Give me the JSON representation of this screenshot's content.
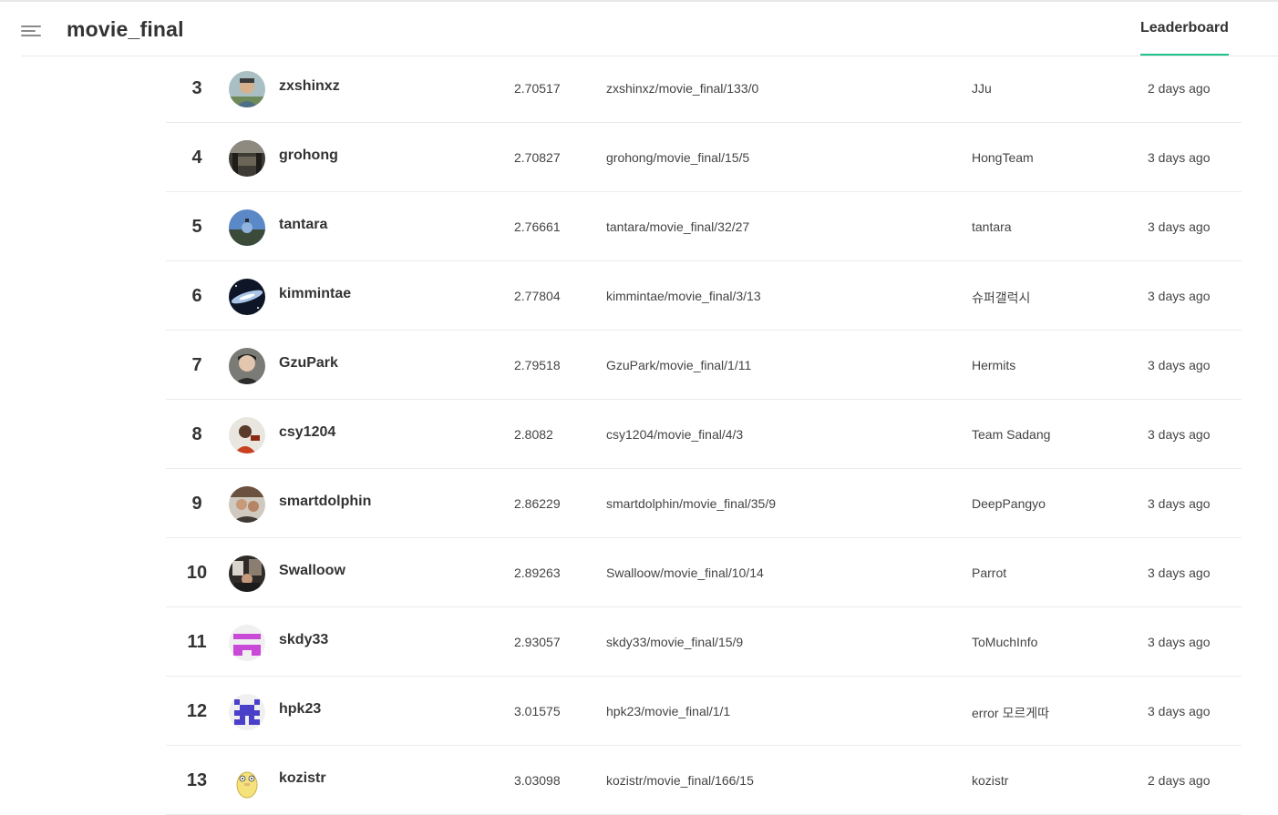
{
  "app": {
    "title": "movie_final"
  },
  "nav": {
    "menu_icon": "hamburger-icon",
    "tabs": [
      {
        "label": "Leaderboard",
        "active": true
      }
    ]
  },
  "colors": {
    "accent": "#1fc28b"
  },
  "rows": [
    {
      "rank": "3",
      "user": "zxshinxz",
      "score": "2.70517",
      "submission": "zxshinxz/movie_final/133/0",
      "team": "JJu",
      "time": "2 days ago"
    },
    {
      "rank": "4",
      "user": "grohong",
      "score": "2.70827",
      "submission": "grohong/movie_final/15/5",
      "team": "HongTeam",
      "time": "3 days ago"
    },
    {
      "rank": "5",
      "user": "tantara",
      "score": "2.76661",
      "submission": "tantara/movie_final/32/27",
      "team": "tantara",
      "time": "3 days ago"
    },
    {
      "rank": "6",
      "user": "kimmintae",
      "score": "2.77804",
      "submission": "kimmintae/movie_final/3/13",
      "team": "슈퍼갤럭시",
      "time": "3 days ago"
    },
    {
      "rank": "7",
      "user": "GzuPark",
      "score": "2.79518",
      "submission": "GzuPark/movie_final/1/11",
      "team": "Hermits",
      "time": "3 days ago"
    },
    {
      "rank": "8",
      "user": "csy1204",
      "score": "2.8082",
      "submission": "csy1204/movie_final/4/3",
      "team": "Team Sadang",
      "time": "3 days ago"
    },
    {
      "rank": "9",
      "user": "smartdolphin",
      "score": "2.86229",
      "submission": "smartdolphin/movie_final/35/9",
      "team": "DeepPangyo",
      "time": "3 days ago"
    },
    {
      "rank": "10",
      "user": "Swalloow",
      "score": "2.89263",
      "submission": "Swalloow/movie_final/10/14",
      "team": "Parrot",
      "time": "3 days ago"
    },
    {
      "rank": "11",
      "user": "skdy33",
      "score": "2.93057",
      "submission": "skdy33/movie_final/15/9",
      "team": "ToMuchInfo",
      "time": "3 days ago"
    },
    {
      "rank": "12",
      "user": "hpk23",
      "score": "3.01575",
      "submission": "hpk23/movie_final/1/1",
      "team": "error 모르게따",
      "time": "3 days ago"
    },
    {
      "rank": "13",
      "user": "kozistr",
      "score": "3.03098",
      "submission": "kozistr/movie_final/166/15",
      "team": "kozistr",
      "time": "2 days ago"
    }
  ]
}
